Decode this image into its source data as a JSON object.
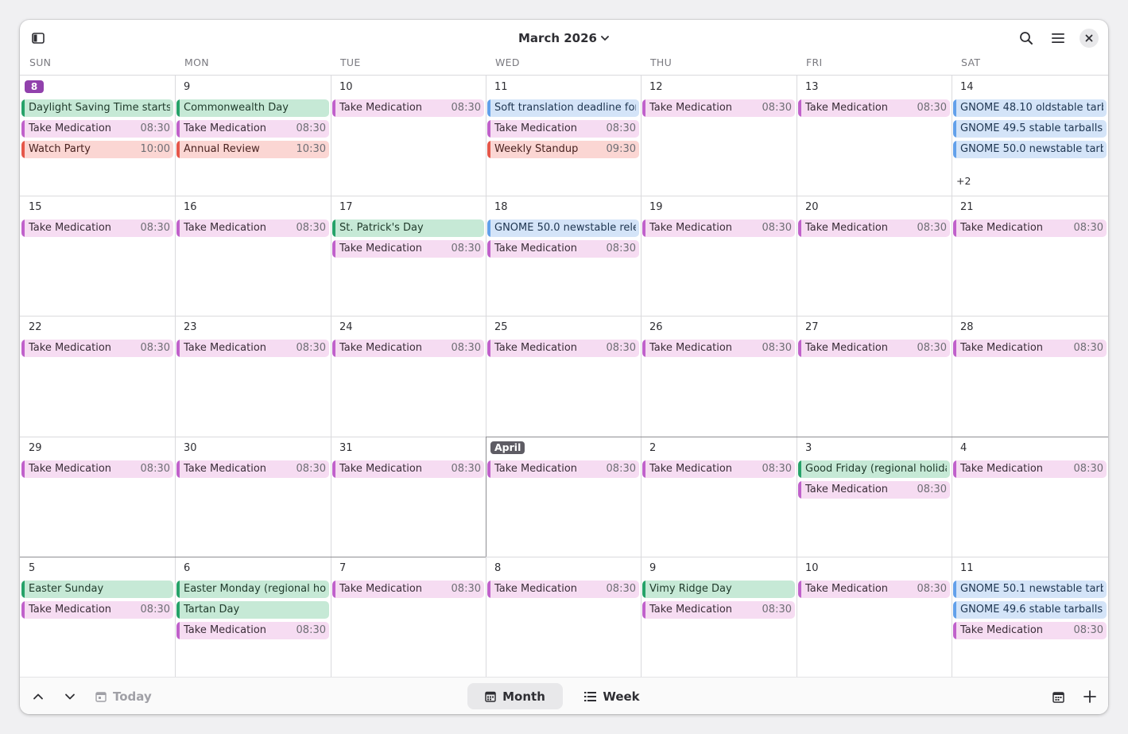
{
  "header": {
    "title": "March 2026"
  },
  "weekdays": [
    "SUN",
    "MON",
    "TUE",
    "WED",
    "THU",
    "FRI",
    "SAT"
  ],
  "weeks": [
    [
      {
        "label": "8",
        "badge": "today",
        "events": [
          {
            "t": "Daylight Saving Time starts",
            "c": "green"
          },
          {
            "t": "Take Medication",
            "time": "08:30",
            "c": "pink"
          },
          {
            "t": "Watch Party",
            "time": "10:00",
            "c": "red"
          }
        ]
      },
      {
        "label": "9",
        "events": [
          {
            "t": "Commonwealth Day",
            "c": "green"
          },
          {
            "t": "Take Medication",
            "time": "08:30",
            "c": "pink"
          },
          {
            "t": "Annual Review",
            "time": "10:30",
            "c": "red"
          }
        ]
      },
      {
        "label": "10",
        "events": [
          {
            "t": "Take Medication",
            "time": "08:30",
            "c": "pink"
          }
        ]
      },
      {
        "label": "11",
        "events": [
          {
            "t": "Soft translation deadline for",
            "c": "blue"
          },
          {
            "t": "Take Medication",
            "time": "08:30",
            "c": "pink"
          },
          {
            "t": "Weekly Standup",
            "time": "09:30",
            "c": "red"
          }
        ]
      },
      {
        "label": "12",
        "events": [
          {
            "t": "Take Medication",
            "time": "08:30",
            "c": "pink"
          }
        ]
      },
      {
        "label": "13",
        "events": [
          {
            "t": "Take Medication",
            "time": "08:30",
            "c": "pink"
          }
        ]
      },
      {
        "label": "14",
        "more": "+2",
        "events": [
          {
            "t": "GNOME 48.10 oldstable tarb",
            "c": "blue"
          },
          {
            "t": "GNOME 49.5 stable tarballs",
            "c": "blue"
          },
          {
            "t": "GNOME 50.0 newstable tarb",
            "c": "blue"
          }
        ]
      }
    ],
    [
      {
        "label": "15",
        "events": [
          {
            "t": "Take Medication",
            "time": "08:30",
            "c": "pink"
          }
        ]
      },
      {
        "label": "16",
        "events": [
          {
            "t": "Take Medication",
            "time": "08:30",
            "c": "pink"
          }
        ]
      },
      {
        "label": "17",
        "events": [
          {
            "t": "St. Patrick's Day",
            "c": "green"
          },
          {
            "t": "Take Medication",
            "time": "08:30",
            "c": "pink"
          }
        ]
      },
      {
        "label": "18",
        "events": [
          {
            "t": "GNOME 50.0 newstable rele",
            "c": "blue"
          },
          {
            "t": "Take Medication",
            "time": "08:30",
            "c": "pink"
          }
        ]
      },
      {
        "label": "19",
        "events": [
          {
            "t": "Take Medication",
            "time": "08:30",
            "c": "pink"
          }
        ]
      },
      {
        "label": "20",
        "events": [
          {
            "t": "Take Medication",
            "time": "08:30",
            "c": "pink"
          }
        ]
      },
      {
        "label": "21",
        "events": [
          {
            "t": "Take Medication",
            "time": "08:30",
            "c": "pink"
          }
        ]
      }
    ],
    [
      {
        "label": "22",
        "events": [
          {
            "t": "Take Medication",
            "time": "08:30",
            "c": "pink"
          }
        ]
      },
      {
        "label": "23",
        "events": [
          {
            "t": "Take Medication",
            "time": "08:30",
            "c": "pink"
          }
        ]
      },
      {
        "label": "24",
        "events": [
          {
            "t": "Take Medication",
            "time": "08:30",
            "c": "pink"
          }
        ]
      },
      {
        "label": "25",
        "events": [
          {
            "t": "Take Medication",
            "time": "08:30",
            "c": "pink"
          }
        ]
      },
      {
        "label": "26",
        "events": [
          {
            "t": "Take Medication",
            "time": "08:30",
            "c": "pink"
          }
        ]
      },
      {
        "label": "27",
        "events": [
          {
            "t": "Take Medication",
            "time": "08:30",
            "c": "pink"
          }
        ]
      },
      {
        "label": "28",
        "events": [
          {
            "t": "Take Medication",
            "time": "08:30",
            "c": "pink"
          }
        ]
      }
    ],
    [
      {
        "label": "29",
        "events": [
          {
            "t": "Take Medication",
            "time": "08:30",
            "c": "pink"
          }
        ]
      },
      {
        "label": "30",
        "events": [
          {
            "t": "Take Medication",
            "time": "08:30",
            "c": "pink"
          }
        ]
      },
      {
        "label": "31",
        "events": [
          {
            "t": "Take Medication",
            "time": "08:30",
            "c": "pink"
          }
        ]
      },
      {
        "label": "April",
        "badge": "month",
        "events": [
          {
            "t": "Take Medication",
            "time": "08:30",
            "c": "pink"
          }
        ]
      },
      {
        "label": "2",
        "events": [
          {
            "t": "Take Medication",
            "time": "08:30",
            "c": "pink"
          }
        ]
      },
      {
        "label": "3",
        "events": [
          {
            "t": "Good Friday (regional holida",
            "c": "green"
          },
          {
            "t": "Take Medication",
            "time": "08:30",
            "c": "pink"
          }
        ]
      },
      {
        "label": "4",
        "events": [
          {
            "t": "Take Medication",
            "time": "08:30",
            "c": "pink"
          }
        ]
      }
    ],
    [
      {
        "label": "5",
        "events": [
          {
            "t": "Easter Sunday",
            "c": "green"
          },
          {
            "t": "Take Medication",
            "time": "08:30",
            "c": "pink"
          }
        ]
      },
      {
        "label": "6",
        "events": [
          {
            "t": "Easter Monday (regional hol",
            "c": "green"
          },
          {
            "t": "Tartan Day",
            "c": "green"
          },
          {
            "t": "Take Medication",
            "time": "08:30",
            "c": "pink"
          }
        ]
      },
      {
        "label": "7",
        "events": [
          {
            "t": "Take Medication",
            "time": "08:30",
            "c": "pink"
          }
        ]
      },
      {
        "label": "8",
        "events": [
          {
            "t": "Take Medication",
            "time": "08:30",
            "c": "pink"
          }
        ]
      },
      {
        "label": "9",
        "events": [
          {
            "t": "Vimy Ridge Day",
            "c": "green"
          },
          {
            "t": "Take Medication",
            "time": "08:30",
            "c": "pink"
          }
        ]
      },
      {
        "label": "10",
        "events": [
          {
            "t": "Take Medication",
            "time": "08:30",
            "c": "pink"
          }
        ]
      },
      {
        "label": "11",
        "events": [
          {
            "t": "GNOME 50.1 newstable tarb",
            "c": "blue"
          },
          {
            "t": "GNOME 49.6 stable tarballs",
            "c": "blue"
          },
          {
            "t": "Take Medication",
            "time": "08:30",
            "c": "pink"
          }
        ]
      }
    ]
  ],
  "footer": {
    "today_label": "Today",
    "month_label": "Month",
    "week_label": "Week",
    "active_view": "month"
  },
  "colors": {
    "accent": "#9141ac",
    "pink": "#c061cb",
    "green": "#26a269",
    "red": "#e5574a",
    "blue": "#62a0ea"
  },
  "icons": [
    "sidebar-toggle-icon",
    "chevron-down-icon",
    "search-icon",
    "menu-icon",
    "close-icon",
    "chevron-up-icon",
    "calendar-day-icon",
    "calendar-month-icon",
    "calendar-week-icon",
    "calendar-icon",
    "plus-icon"
  ]
}
